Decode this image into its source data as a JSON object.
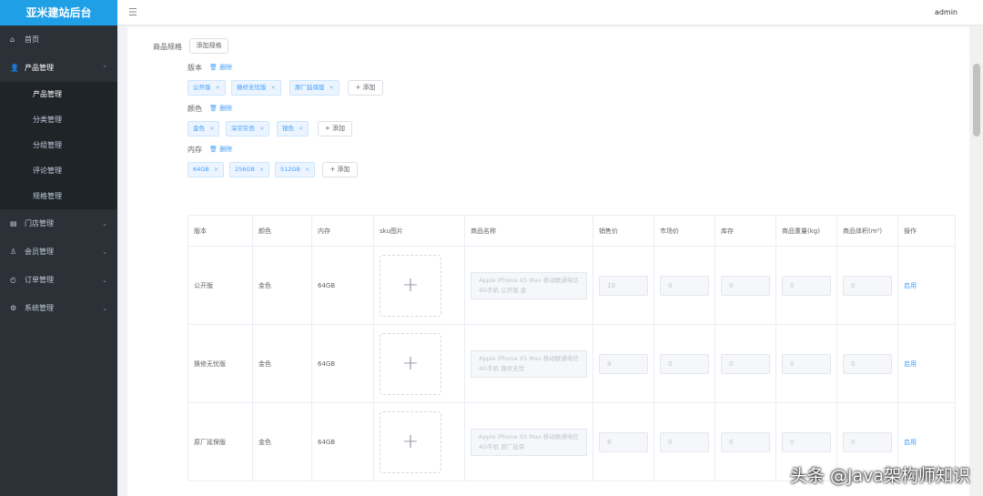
{
  "app_title": "亚米建站后台",
  "user": "admin",
  "sidebar": {
    "home": "首页",
    "product": "产品管理",
    "product_sub": [
      "产品管理",
      "分类管理",
      "分组管理",
      "评论管理",
      "规格管理"
    ],
    "menus": [
      "门店管理",
      "会员管理",
      "订单管理",
      "系统管理"
    ]
  },
  "spec": {
    "label": "商品规格",
    "add_spec": "添加规格",
    "delete": "删除",
    "add": "+ 添加",
    "groups": [
      {
        "name": "版本",
        "tags": [
          "公开版",
          "换修无忧版",
          "原厂延保版"
        ]
      },
      {
        "name": "颜色",
        "tags": [
          "金色",
          "深空灰色",
          "银色"
        ]
      },
      {
        "name": "内存",
        "tags": [
          "64GB",
          "256GB",
          "512GB"
        ]
      }
    ]
  },
  "table": {
    "headers": [
      "版本",
      "颜色",
      "内存",
      "sku图片",
      "商品名称",
      "销售价",
      "市场价",
      "库存",
      "商品重量(kg)",
      "商品体积(m³)",
      "操作"
    ],
    "rows": [
      {
        "version": "公开版",
        "color": "金色",
        "memory": "64GB",
        "name": "Apple iPhone XS Max 移动联通电信4G手机 公开版 金",
        "price": "10",
        "market": "0",
        "stock": "0",
        "weight": "0",
        "volume": "0",
        "action": "启用"
      },
      {
        "version": "换修无忧版",
        "color": "金色",
        "memory": "64GB",
        "name": "Apple iPhone XS Max 移动联通电信4G手机 换修无忧",
        "price": "9",
        "market": "0",
        "stock": "0",
        "weight": "0",
        "volume": "0",
        "action": "启用"
      },
      {
        "version": "原厂延保版",
        "color": "金色",
        "memory": "64GB",
        "name": "Apple iPhone XS Max 移动联通电信4G手机 原厂延保",
        "price": "8",
        "market": "0",
        "stock": "0",
        "weight": "0",
        "volume": "0",
        "action": "启用"
      }
    ]
  },
  "watermark": "头条 @Java架构师知识"
}
